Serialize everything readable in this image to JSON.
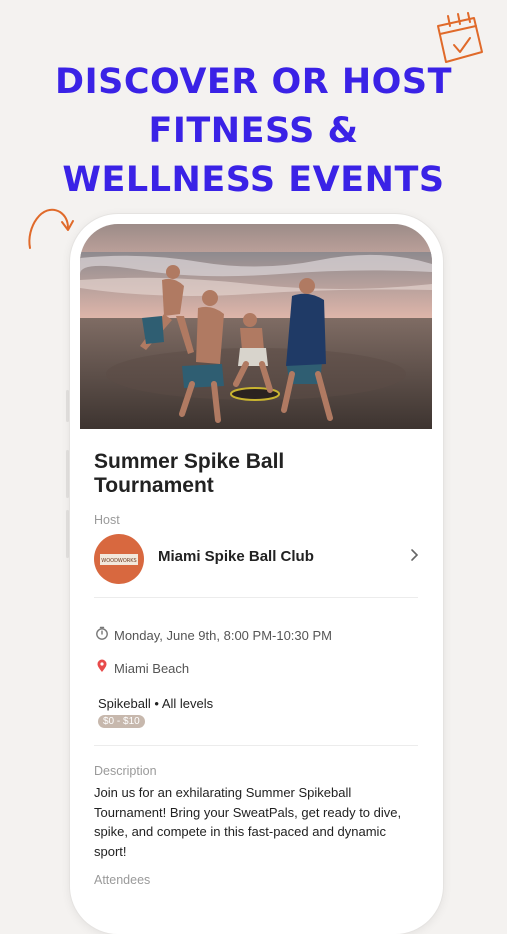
{
  "headline": {
    "line1": "DISCOVER OR HOST",
    "line2": "FITNESS &",
    "line3": "WELLNESS EVENTS"
  },
  "colors": {
    "headline": "#3a22e6",
    "accent_orange": "#e06a2a",
    "avatar_bg": "#d8683f",
    "price_badge": "#c7b8ad"
  },
  "event": {
    "title": "Summer Spike Ball Tournament",
    "host_label": "Host",
    "host_name": "Miami Spike Ball Club",
    "host_logo_text": "WOODWORKS",
    "datetime": "Monday, June 9th, 8:00 PM-10:30 PM",
    "location": "Miami Beach",
    "tags": "Spikeball • All levels",
    "price": "$0 - $10",
    "description_label": "Description",
    "description": "Join us for an exhilarating Summer Spikeball Tournament! Bring your SweatPals, get ready to dive, spike, and compete in this fast-paced and dynamic sport!",
    "attendees_label": "Attendees"
  },
  "icons": {
    "calendar": "calendar-check-icon",
    "arrow": "curved-arrow-icon",
    "clock": "stopwatch-icon",
    "pin": "location-pin-icon",
    "chevron": "chevron-right-icon"
  }
}
